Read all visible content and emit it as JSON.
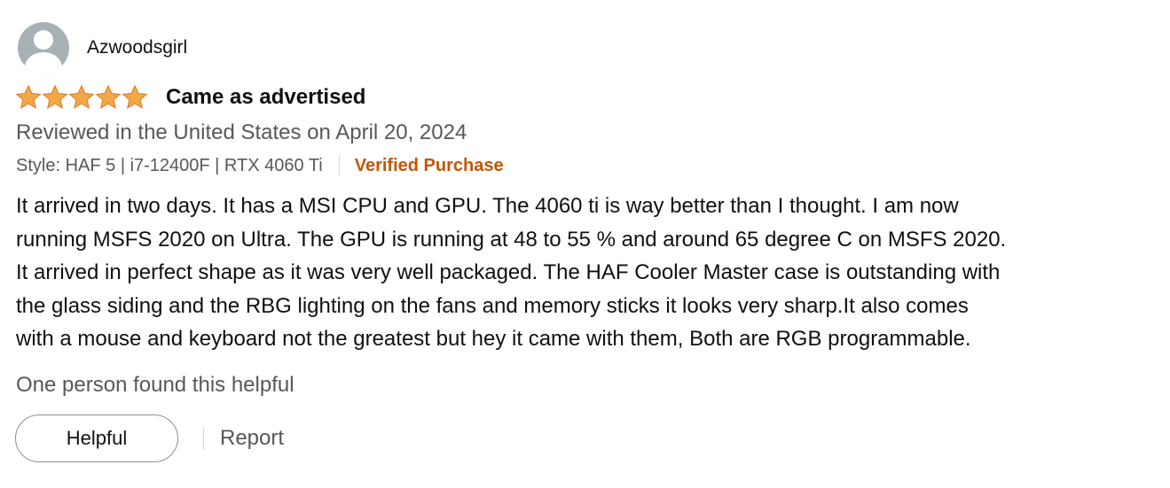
{
  "profile": {
    "name": "Azwoodsgirl",
    "avatar_icon": "user-avatar-icon"
  },
  "review": {
    "rating": 5,
    "rating_max": 5,
    "star_color": "#f3a847",
    "title": "Came as advertised",
    "date": "Reviewed in the United States on April 20, 2024",
    "style": "Style: HAF 5 | i7-12400F | RTX 4060 Ti",
    "verified": "Verified Purchase",
    "body_lines": [
      "It arrived in two days. It has a MSI CPU and GPU. The 4060 ti is way better than I thought. I am now",
      "running MSFS 2020 on Ultra. The GPU is running at 48 to 55 % and around 65 degree C on MSFS 2020.",
      "It arrived in perfect shape as it was very well packaged. The HAF Cooler Master case is outstanding with",
      "the glass siding and the RBG lighting on the fans and memory sticks it looks very sharp.It also comes",
      "with a mouse and keyboard not the greatest but hey it came with them, Both are RGB programmable."
    ],
    "helpful_count": "One person found this helpful"
  },
  "actions": {
    "helpful_label": "Helpful",
    "report_label": "Report"
  }
}
